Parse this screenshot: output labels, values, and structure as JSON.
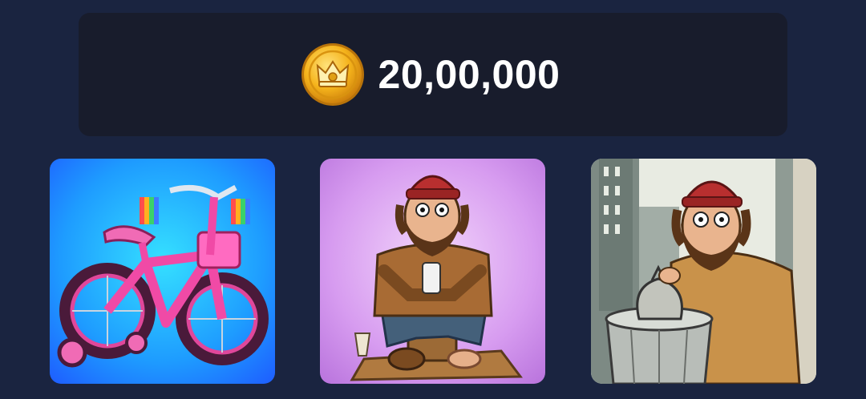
{
  "balance": {
    "icon": "gold-crown-coin-icon",
    "amount": "20,00,000"
  },
  "items": [
    {
      "icon": "pink-kids-bicycle-image",
      "background": "#1e6bff"
    },
    {
      "icon": "homeless-man-with-phone-image",
      "background": "#d79cf0"
    },
    {
      "icon": "homeless-man-with-trash-bag-image",
      "background": "#8c9590"
    }
  ],
  "colors": {
    "page_background": "#1a2440",
    "panel_background": "#181c2c",
    "coin_gold": "#f5b41c",
    "text": "#ffffff"
  }
}
